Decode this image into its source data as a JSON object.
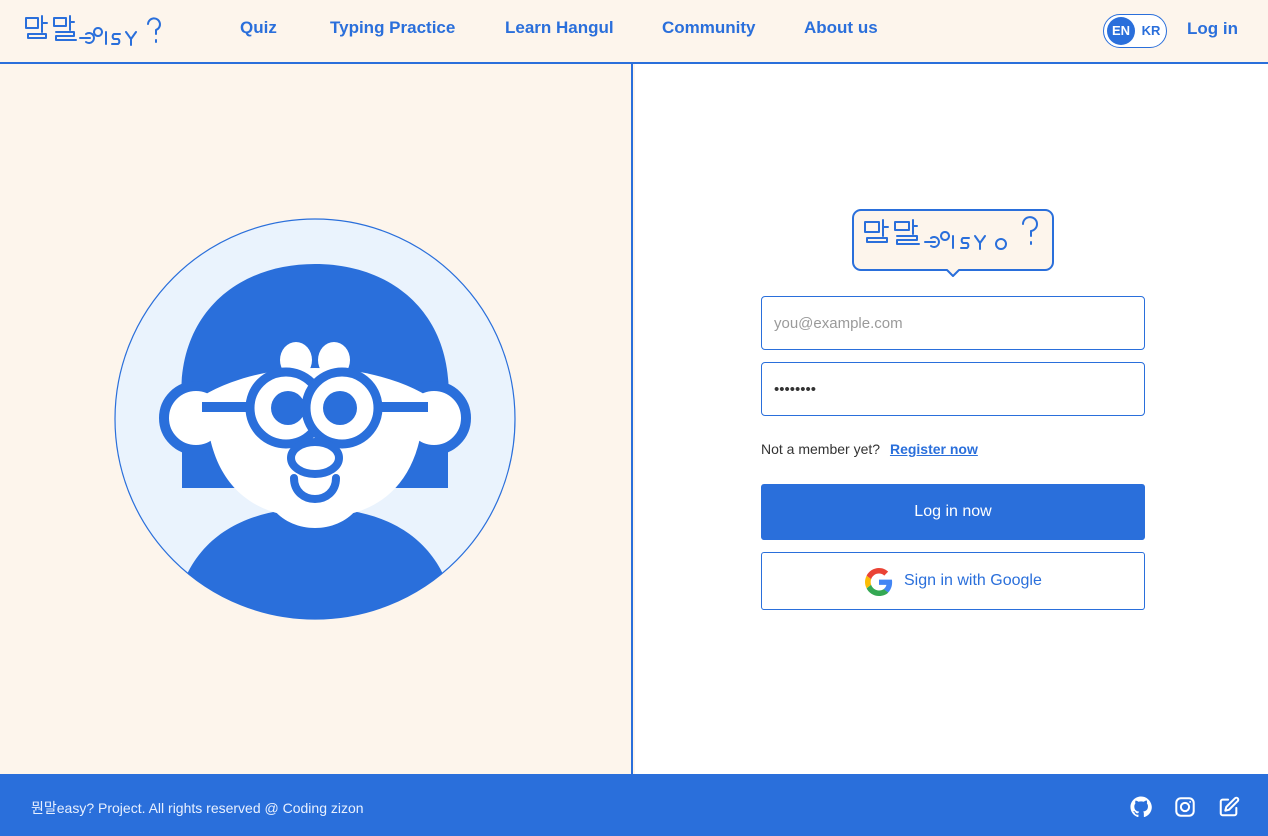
{
  "header": {
    "logo_text": "뭔말easy?",
    "nav": [
      {
        "label": "Quiz"
      },
      {
        "label": "Typing Practice"
      },
      {
        "label": "Learn Hangul"
      },
      {
        "label": "Community"
      },
      {
        "label": "About us"
      }
    ],
    "lang": {
      "en": "EN",
      "kr": "KR",
      "active": "EN"
    },
    "login_label": "Log in"
  },
  "login_form": {
    "email_placeholder": "you@example.com",
    "password_value": "••••••••",
    "not_member_text": "Not a member yet?",
    "register_label": "Register now",
    "login_button": "Log in now",
    "google_button": "Sign in with Google"
  },
  "footer": {
    "copyright": "뭔말easy? Project. All rights reserved @ Coding zizon",
    "icons": [
      "github-icon",
      "instagram-icon",
      "edit-icon"
    ]
  },
  "colors": {
    "brand": "#2a6fdb",
    "background": "#fdf5ec",
    "avatar_bg": "#eaf3fd"
  }
}
